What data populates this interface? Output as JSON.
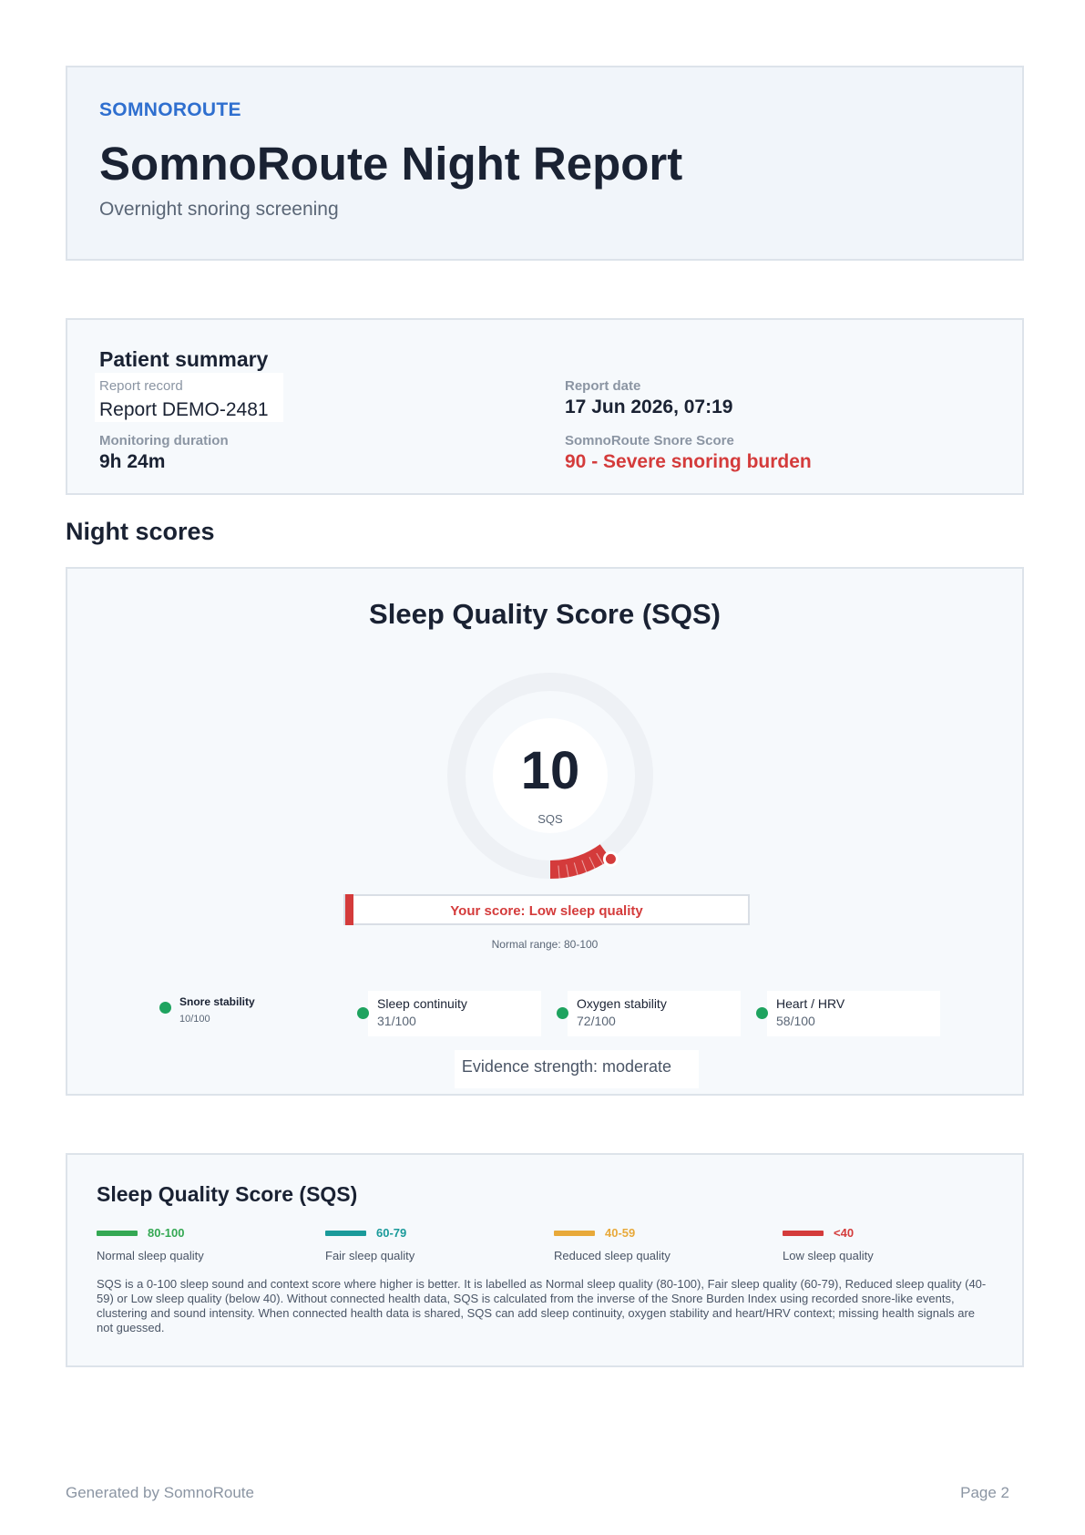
{
  "header": {
    "brand": "SOMNOROUTE",
    "title": "SomnoRoute Night Report",
    "subtitle": "Overnight snoring screening"
  },
  "patient": {
    "section_title": "Patient summary",
    "record_label": "Report record",
    "record_value": "Report DEMO-2481",
    "date_label": "Report date",
    "date_value": "17 Jun 2026, 07:19",
    "duration_label": "Monitoring duration",
    "duration_value": "9h 24m",
    "snore_label": "SomnoRoute Snore Score",
    "snore_value": "90 - Severe snoring burden"
  },
  "night_scores": {
    "section_title": "Night scores",
    "sqs_title": "Sleep Quality Score (SQS)",
    "score": "10",
    "score_unit": "SQS",
    "score_fraction": 0.1,
    "band_text": "Your score: Low sleep quality",
    "normal_range": "Normal range: 80-100",
    "components": [
      {
        "name": "Snore stability",
        "value": "10/100"
      },
      {
        "name": "Sleep continuity",
        "value": "31/100"
      },
      {
        "name": "Oxygen stability",
        "value": "72/100"
      },
      {
        "name": "Heart / HRV",
        "value": "58/100"
      }
    ],
    "evidence": "Evidence strength: moderate",
    "colors": {
      "low": "#d43b3b",
      "track": "#eef1f5",
      "ok": "#1ea35f"
    }
  },
  "legend": {
    "title": "Sleep Quality Score (SQS)",
    "items": [
      {
        "range": "80-100",
        "label": "Normal sleep quality",
        "color": "#34a853"
      },
      {
        "range": "60-79",
        "label": "Fair sleep quality",
        "color": "#1a9a9a"
      },
      {
        "range": "40-59",
        "label": "Reduced sleep quality",
        "color": "#e8a93a"
      },
      {
        "range": "<40",
        "label": "Low sleep quality",
        "color": "#d43b3b"
      }
    ],
    "description": "SQS is a 0-100 sleep sound and context score where higher is better. It is labelled as Normal sleep quality (80-100), Fair sleep quality (60-79), Reduced sleep quality (40-59) or Low sleep quality (below 40). Without connected health data, SQS is calculated from the inverse of the Snore Burden Index using recorded snore-like events, clustering and sound intensity. When connected health data is shared, SQS can add sleep continuity, oxygen stability and heart/HRV context; missing health signals are not guessed."
  },
  "footer": {
    "left": "Generated by SomnoRoute",
    "right": "Page 2"
  }
}
